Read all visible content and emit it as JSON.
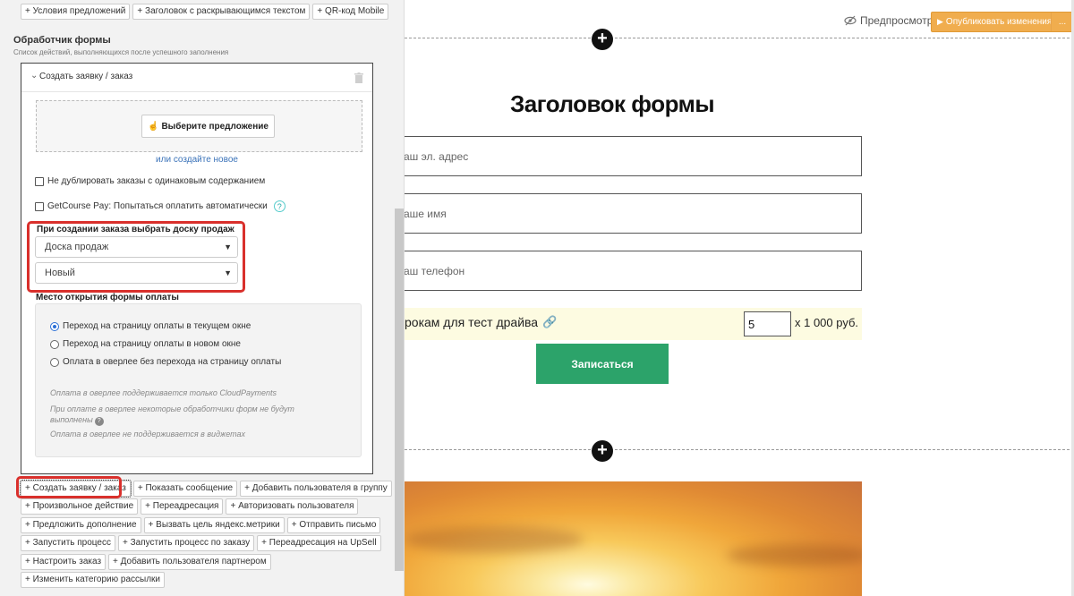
{
  "left_panel": {
    "top_buttons": [
      "+ Условия предложений",
      "+ Заголовок с раскрывающимся текстом",
      "+ QR-код Mobile"
    ],
    "handler_title": "Обработчик формы",
    "handler_desc": "Список действий, выполняющихся после успешного заполнения",
    "action": {
      "title": "Создать заявку / заказ",
      "offer_button": "Выберите предложение",
      "or_create_link": "или создайте новое",
      "no_duplicates": "Не дублировать заказы с одинаковым содержанием",
      "getcourse_pay": "GetCourse Pay: Попытаться оплатить автоматически",
      "help_glyph": "?",
      "board_label": "При создании заказа выбрать доску продаж",
      "board_select": "Доска продаж",
      "stage_select": "Новый",
      "pay_label": "Место открытия формы оплаты",
      "radio_options": [
        {
          "label": "Переход на страницу оплаты в текущем окне",
          "checked": true
        },
        {
          "label": "Переход на страницу оплаты в новом окне",
          "checked": false
        },
        {
          "label": "Оплата в оверлее без перехода на страницу оплаты",
          "checked": false
        }
      ],
      "notes": [
        "Оплата в оверлее поддерживается только CloudPayments",
        "При оплате в оверлее некоторые обработчики форм не будут выполнены",
        "Оплата в оверлее не поддерживается в виджетах"
      ]
    },
    "bottom_buttons": [
      [
        "+ Создать заявку / заказ",
        "+ Показать сообщение",
        "+ Добавить пользователя в группу"
      ],
      [
        "+ Произвольное действие",
        "+ Переадресация",
        "+ Авторизовать пользователя"
      ],
      [
        "+ Предложить дополнение",
        "+ Вызвать цель яндекс.метрики",
        "+ Отправить письмо"
      ],
      [
        "+ Запустить процесс",
        "+ Запустить процесс по заказу",
        "+ Переадресация на UpSell"
      ],
      [
        "+ Настроить заказ",
        "+ Добавить пользователя партнером"
      ],
      [
        "+ Изменить категорию рассылки"
      ]
    ]
  },
  "toolbar": {
    "preview": "Предпросмотр",
    "publish": "Опубликовать изменения",
    "publish_more": "...",
    "plus": "+"
  },
  "form": {
    "title": "Заголовок формы",
    "fields": [
      "аш эл. адрес",
      "аше имя",
      "аш телефон"
    ],
    "product_name": "рокам для тест драйва",
    "quantity": "5",
    "price": "x 1 000 руб.",
    "submit": "Записаться"
  },
  "colors": {
    "publish": "#f0ad4e",
    "submit": "#2ca36a",
    "highlight": "#d9302c",
    "link": "#3b73b9"
  }
}
